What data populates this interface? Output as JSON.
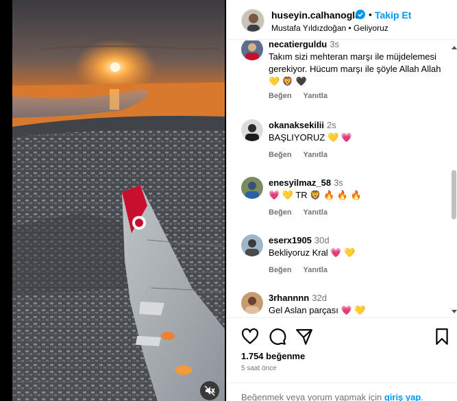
{
  "post": {
    "author": "huseyin.calhanoglu",
    "follow_label": "Takip Et",
    "separator": "•",
    "subtitle": "Mustafa Yıldızdoğan • Geliyoruz",
    "verified": true
  },
  "comments": [
    {
      "user": "necatierguldu",
      "time": "3s",
      "text": "Takım sizi mehteran marşı ile müjdelemesi gerekiyor. Hücum marşı ile şöyle Allah Allah 💛 🦁 🖤",
      "like_label": "Beğen",
      "reply_label": "Yanıtla"
    },
    {
      "user": "okanaksekilii",
      "time": "2s",
      "text": "BAŞLIYORUZ 💛 💗",
      "like_label": "Beğen",
      "reply_label": "Yanıtla"
    },
    {
      "user": "enesyilmaz_58",
      "time": "3s",
      "text": "💗 💛 TR 🦁 🔥 🔥 🔥",
      "like_label": "Beğen",
      "reply_label": "Yanıtla"
    },
    {
      "user": "eserx1905",
      "time": "30d",
      "text": "Bekliyoruz Kral 💗 💛",
      "like_label": "Beğen",
      "reply_label": "Yanıtla"
    },
    {
      "user": "3rhannnn",
      "time": "32d",
      "text": "Gel Aslan parçası 💗 💛",
      "like_label": "Beğen",
      "reply_label": "Yanıtla"
    }
  ],
  "stats": {
    "likes": "1.754 beğenme",
    "time_ago": "5 saat önce"
  },
  "footer": {
    "prompt": "Beğenmek veya yorum yapmak için",
    "link": "giriş yap",
    "end": "."
  },
  "icons": {
    "mute": "speaker-muted-icon",
    "like": "heart-icon",
    "comment": "comment-bubble-icon",
    "share": "paper-plane-icon",
    "save": "bookmark-icon",
    "verified": "verified-badge-icon"
  },
  "colors": {
    "accent": "#0095f6",
    "muted": "#737373",
    "heart": "#ff3b6b",
    "gold": "#f5b800"
  }
}
